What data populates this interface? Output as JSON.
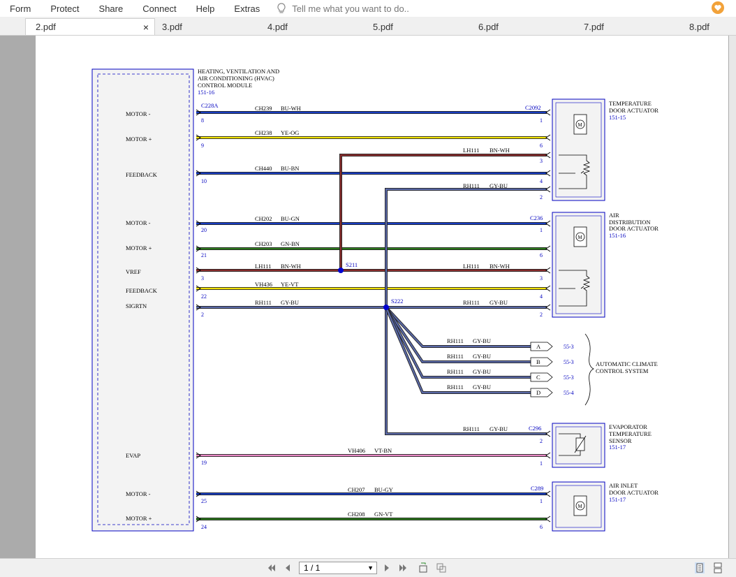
{
  "menu": {
    "items": [
      "Form",
      "Protect",
      "Share",
      "Connect",
      "Help",
      "Extras"
    ],
    "tell_me": "Tell me what you want to do.."
  },
  "tabs": [
    {
      "label": "2.pdf",
      "active": true
    },
    {
      "label": "3.pdf"
    },
    {
      "label": "4.pdf"
    },
    {
      "label": "5.pdf"
    },
    {
      "label": "6.pdf"
    },
    {
      "label": "7.pdf"
    },
    {
      "label": "8.pdf"
    }
  ],
  "tab_close": "×",
  "pager": {
    "value": "1 / 1"
  },
  "diagram": {
    "module": {
      "title_lines": [
        "HEATING, VENTILATION AND",
        "AIR CONDITIONING (HVAC)",
        "CONTROL MODULE"
      ],
      "ref": "151-16",
      "connector": "C228A"
    },
    "pins": [
      {
        "name": "MOTOR -",
        "num": "8"
      },
      {
        "name": "MOTOR +",
        "num": "9"
      },
      {
        "name": "FEEDBACK",
        "num": "10"
      },
      {
        "name": "MOTOR -",
        "num": "20"
      },
      {
        "name": "MOTOR +",
        "num": "21"
      },
      {
        "name": "VREF",
        "num": "3"
      },
      {
        "name": "FEEDBACK",
        "num": "22"
      },
      {
        "name": "SIGRTN",
        "num": "2"
      },
      {
        "name": "EVAP",
        "num": "19"
      },
      {
        "name": "MOTOR -",
        "num": "25"
      },
      {
        "name": "MOTOR +",
        "num": "24"
      }
    ],
    "wires": [
      {
        "circuit": "CH239",
        "color": "BU-WH"
      },
      {
        "circuit": "CH238",
        "color": "YE-OG"
      },
      {
        "circuit": "CH440",
        "color": "BU-BN"
      },
      {
        "circuit": "CH202",
        "color": "BU-GN"
      },
      {
        "circuit": "CH203",
        "color": "GN-BN"
      },
      {
        "circuit": "LH111",
        "color": "BN-WH"
      },
      {
        "circuit": "VH436",
        "color": "YE-VT"
      },
      {
        "circuit": "RH111",
        "color": "GY-BU"
      },
      {
        "circuit": "VH406",
        "color": "VT-BN"
      },
      {
        "circuit": "CH207",
        "color": "BU-GY"
      },
      {
        "circuit": "CH208",
        "color": "GN-VT"
      }
    ],
    "splices": [
      "S211",
      "S222"
    ],
    "temp_actuator": {
      "lines": [
        "TEMPERATURE",
        "DOOR ACTUATOR"
      ],
      "ref": "151-15",
      "connector": "C2092",
      "pins": [
        "1",
        "6",
        "3",
        "4",
        "2"
      ]
    },
    "air_dist_actuator": {
      "lines": [
        "AIR",
        "DISTRIBUTION",
        "DOOR ACTUATOR"
      ],
      "ref": "151-16",
      "connector": "C236",
      "pins": [
        "1",
        "6",
        "3",
        "4",
        "2"
      ]
    },
    "climate_system": {
      "lines": [
        "AUTOMATIC CLIMATE",
        "CONTROL SYSTEM"
      ],
      "branches": [
        {
          "id": "A",
          "ref": "55-3"
        },
        {
          "id": "B",
          "ref": "55-3"
        },
        {
          "id": "C",
          "ref": "55-3"
        },
        {
          "id": "D",
          "ref": "55-4"
        }
      ]
    },
    "evap_sensor": {
      "lines": [
        "EVAPORATOR",
        "TEMPERATURE",
        "SENSOR"
      ],
      "ref": "151-17",
      "connector": "C296",
      "pins": [
        "2",
        "1"
      ]
    },
    "air_inlet_actuator": {
      "lines": [
        "AIR INLET",
        "DOOR ACTUATOR"
      ],
      "ref": "151-17",
      "connector": "C289",
      "pins": [
        "1",
        "6"
      ]
    },
    "colors": {
      "connector_blue": "#0000c0",
      "wire_blue": "#1a3fc4",
      "wire_yellow": "#f2e300",
      "wire_green": "#2e7a1e",
      "wire_brown": "#8b2e2e",
      "wire_grayblue": "#5b6aa8",
      "wire_violet": "#e98ac6"
    }
  }
}
